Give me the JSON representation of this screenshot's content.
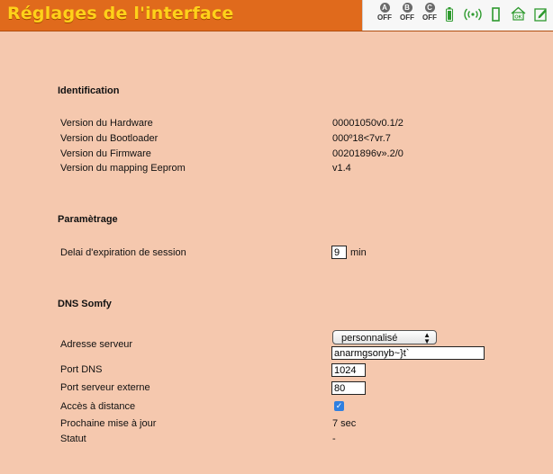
{
  "header": {
    "title": "Réglages de l'interface",
    "status": {
      "a": {
        "letter": "A",
        "state": "OFF"
      },
      "b": {
        "letter": "B",
        "state": "OFF"
      },
      "c": {
        "letter": "C",
        "state": "OFF"
      }
    },
    "icons": [
      "battery-icon",
      "signal-icon",
      "door-icon",
      "home-ok-icon",
      "edit-icon"
    ],
    "home_ok_label": "OK"
  },
  "identification": {
    "title": "Identification",
    "rows": [
      {
        "label": "Version du Hardware",
        "value": "00001050v0.1/2"
      },
      {
        "label": "Version du Bootloader",
        "value": "000º18<7vr.7"
      },
      {
        "label": "Version du Firmware",
        "value": "00201896v».2/0"
      },
      {
        "label": "Version du mapping Eeprom",
        "value": "v1.4"
      }
    ]
  },
  "parametrage": {
    "title": "Paramètrage",
    "session_label": "Delai d'expiration de session",
    "session_value": "9",
    "session_unit": "min"
  },
  "dns": {
    "title": "DNS Somfy",
    "server_label": "Adresse serveur",
    "server_mode": "personnalisé",
    "server_value": "anarmgsonyb~}t`",
    "port_dns_label": "Port DNS",
    "port_dns_value": "1024",
    "port_ext_label": "Port serveur externe",
    "port_ext_value": "80",
    "remote_label": "Accès à distance",
    "remote_checked": true,
    "next_update_label": "Prochaine mise à jour",
    "next_update_value": "7 sec",
    "status_label": "Statut",
    "status_value": "-"
  },
  "colors": {
    "header_bg": "#e06a1c",
    "title": "#ffd11a",
    "page_bg": "#f5c8ae",
    "icon_green": "#2e9a2e"
  }
}
